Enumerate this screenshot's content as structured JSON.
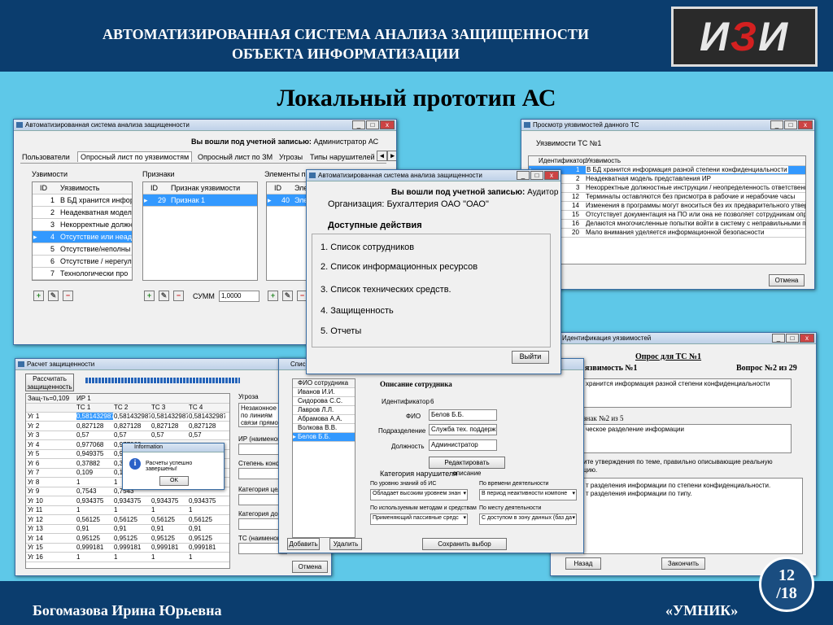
{
  "header": {
    "title_line1": "АВТОМАТИЗИРОВАННАЯ СИСТЕМА АНАЛИЗА ЗАЩИЩЕННОСТИ",
    "title_line2": "ОБЪЕКТА ИНФОРМАТИЗАЦИИ",
    "logo_text_left": "И",
    "logo_text_mid": "З",
    "logo_text_right": "И"
  },
  "slide_title": "Локальный прототип АС",
  "footer": {
    "author": "Богомазова Ирина Юрьевна",
    "brand": "«УМНИК»",
    "page": "12",
    "total": "/18"
  },
  "win1": {
    "title": "Автоматизированная система анализа защищенности",
    "login_label": "Вы вошли под учетной записью:",
    "login_user": "Администратор АС",
    "tabs": [
      "Пользователи",
      "Опросный лист по уязвимостям",
      "Опросный лист по ЗМ",
      "Угрозы",
      "Типы нарушителей"
    ],
    "vuln_label": "Узвимости",
    "signs_label": "Признаки",
    "elements_label": "Элементы п",
    "vuln_headers": [
      "ID",
      "Уязвимость"
    ],
    "vulns": [
      [
        "1",
        "В БД хранится инфор"
      ],
      [
        "2",
        "Неадекватная модел"
      ],
      [
        "3",
        "Некорректные должн"
      ],
      [
        "4",
        "Отсутствие или неад"
      ],
      [
        "5",
        "Отсутствие/неполны"
      ],
      [
        "6",
        "Отсутствие / нерегул"
      ],
      [
        "7",
        "Технологически про"
      ]
    ],
    "sign_headers": [
      "ID",
      "Признак уязвимости"
    ],
    "signs": [
      [
        "29",
        "Признак 1"
      ]
    ],
    "elem_headers": [
      "ID",
      "Эле"
    ],
    "elems": [
      [
        "40",
        "Эле"
      ]
    ],
    "sum_label": "СУММ",
    "sum_value": "1,0000"
  },
  "win2": {
    "title": "Просмотр уязвимостей данного ТС",
    "subtitle": "Уязвимости ТС №1",
    "headers": [
      "Идентификатор",
      "Уязвимость"
    ],
    "rows": [
      [
        "1",
        "В БД хранится информация разной степени конфиденциальности"
      ],
      [
        "2",
        "Неадекватная модель представления ИР"
      ],
      [
        "3",
        "Некорректные должностные инструкции / неопределенность ответственности"
      ],
      [
        "12",
        "Терминалы оставляются без присмотра в рабочие и нерабочие часы"
      ],
      [
        "14",
        "Изменения в программы могут вноситься без их предварительного утверждения"
      ],
      [
        "15",
        "Отсутствует документация на ПО или она не позволяет сотрудникам определить"
      ],
      [
        "16",
        "Делаются многочисленные попытки войти в систему с неправильными паролями"
      ],
      [
        "20",
        "Мало внимания уделяется информационной безопасности"
      ]
    ],
    "close_btn": "Отмена"
  },
  "win3": {
    "title": "Автоматизированная система анализа защищенности",
    "login_label": "Вы вошли под учетной записью:",
    "login_user": "Аудитор",
    "org": "Организация: Бухгалтерия ОАО \"ОАО\"",
    "actions_title": "Доступные действия",
    "actions": [
      "1. Список сотрудников",
      "2. Список информационных ресурсов",
      "3. Список технических средств.",
      "4. Защищенность",
      "5. Отчеты"
    ],
    "exit_btn": "Выйти"
  },
  "win4": {
    "title": "Расчет защищенности",
    "calc_btn": "Рассчитать защищенность",
    "h1": "Защ-ть=0,109",
    "h2": "ИР 1",
    "cols": [
      "ТС 1",
      "ТС 2",
      "ТС 3",
      "ТС 4"
    ],
    "rows": [
      [
        "Уг 1",
        "0,5814329879",
        "0,5814329879",
        "0,5814329879",
        "0,5814329879"
      ],
      [
        "Уг 2",
        "0,827128",
        "0,827128",
        "0,827128",
        "0,827128"
      ],
      [
        "Уг 3",
        "0,57",
        "0,57",
        "0,57",
        "0,57"
      ],
      [
        "Уг 4",
        "0,977068",
        "0,977068",
        "",
        ""
      ],
      [
        "Уг 5",
        "0,949375",
        "0,9493",
        "",
        ""
      ],
      [
        "Уг 6",
        "0,37882",
        "0,378",
        "",
        ""
      ],
      [
        "Уг 7",
        "0,109",
        "0,109",
        "",
        ""
      ],
      [
        "Уг 8",
        "1",
        "1",
        "",
        ""
      ],
      [
        "Уг 9",
        "0,7543",
        "0,7543",
        "",
        ""
      ],
      [
        "Уг 10",
        "0,934375",
        "0,934375",
        "0,934375",
        "0,934375"
      ],
      [
        "Уг 11",
        "1",
        "1",
        "1",
        "1"
      ],
      [
        "Уг 12",
        "0,56125",
        "0,56125",
        "0,56125",
        "0,56125"
      ],
      [
        "Уг 13",
        "0,91",
        "0,91",
        "0,91",
        "0,91"
      ],
      [
        "Уг 14",
        "0,95125",
        "0,95125",
        "0,95125",
        "0,95125"
      ],
      [
        "Уг 15",
        "0,999181",
        "0,999181",
        "0,999181",
        "0,999181"
      ],
      [
        "Уг 16",
        "1",
        "1",
        "1",
        "1"
      ]
    ],
    "side_labels": [
      "Угроза",
      "Незаконное по линиям связи прямой подкл",
      "ИР (наименова",
      "Степень конфид",
      "Категория целос",
      "Категория дост",
      "ТС (наименова"
    ],
    "cancel_btn": "Отмена",
    "info_title": "Information",
    "info_msg": "Расчеты успешно завершены!",
    "info_ok": "OK"
  },
  "win5": {
    "title": "Списо",
    "list_header": "ФИО сотрудника",
    "list": [
      "Иванов И.И.",
      "Сидорова С.С.",
      "Лавров Л.Л.",
      "Абрамова А.А.",
      "Волкова В.В.",
      "Белов Б.Б."
    ],
    "section": "Описание сотрудника",
    "id_label": "Идентификатор",
    "id_value": "6",
    "fio_label": "ФИО",
    "fio_value": "Белов Б.Б.",
    "dept_label": "Подразделение",
    "dept_value": "Служба тех. поддержки",
    "pos_label": "Должность",
    "pos_value": "Администратор",
    "edit_btn": "Редактировать описание",
    "cat_title": "Категория нарушителя",
    "k1": "По уровню знаний об ИС",
    "v1": "Обладает высоким уровнем знан",
    "k2": "По времени деятельности",
    "v2": "В период неактивности компоне",
    "k3": "По используемым методам и средствам",
    "v3": "Применяющий пассивные средс",
    "k4": "По месту деятельности",
    "v4": "С доступом в зону данных (баз да",
    "add_btn": "Добавить",
    "del_btn": "Удалить",
    "save_btn": "Сохранить выбор категории"
  },
  "win6": {
    "title": "Идентификация уязвимостей",
    "q1": "Опрос для ТС №1",
    "q2l": "язвимость №1",
    "q2r": "Вопрос №2 из 29",
    "t1": "хранится информация разной степени конфиденциальности",
    "p2": "знак №2 из 5",
    "t2": "ческое разделение информации",
    "p3a": "ите утверждения по теме, правильно описывающие реальную",
    "p3b": "цию.",
    "t3a": "т разделения информации по степени конфиденциальности.",
    "t3b": "т разделения информации по типу.",
    "back_btn": "Назад",
    "finish_btn": "Закончить"
  }
}
